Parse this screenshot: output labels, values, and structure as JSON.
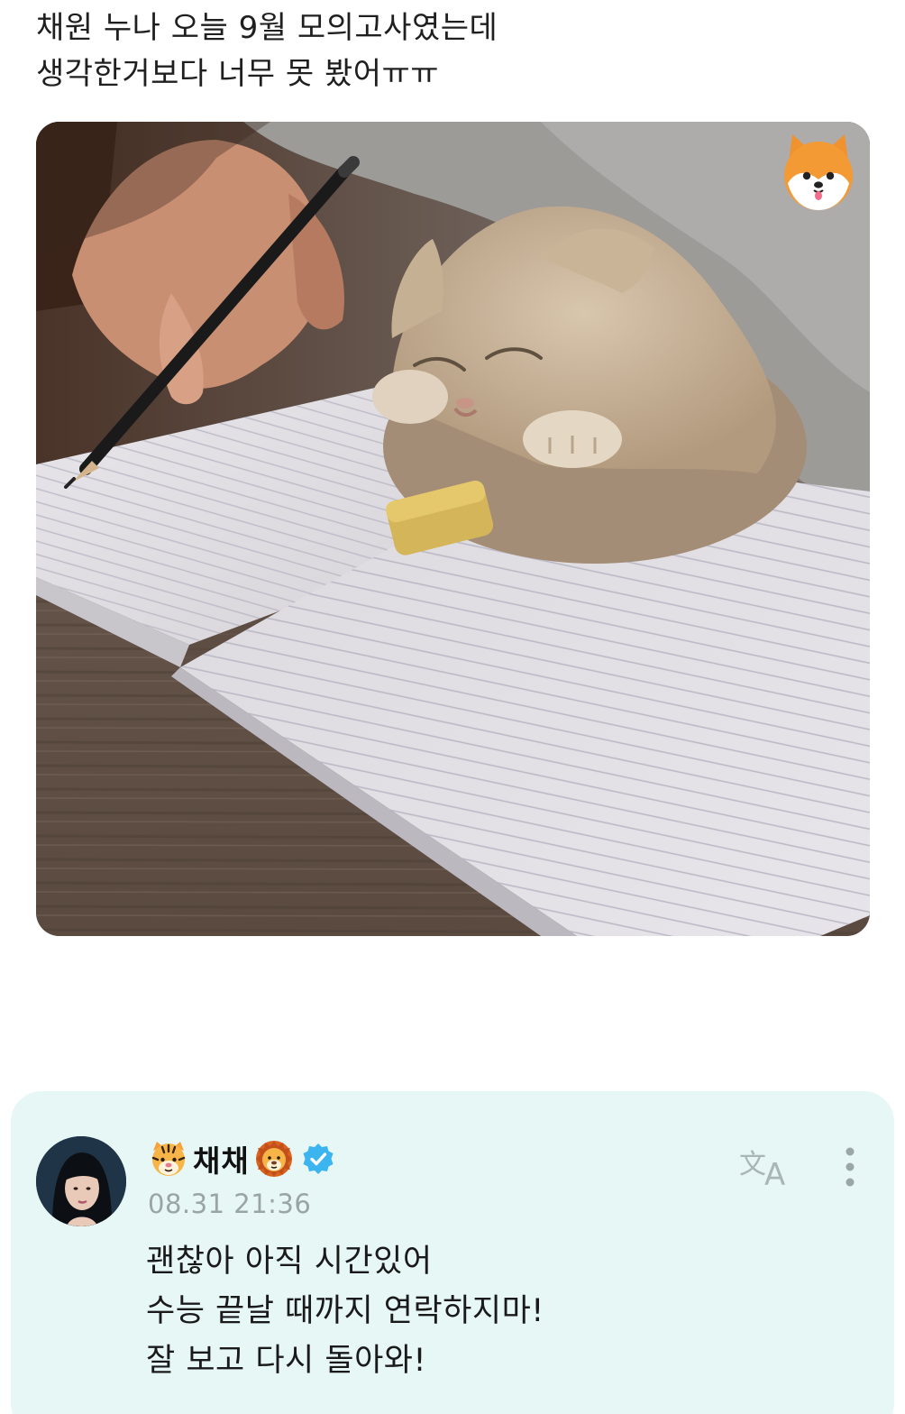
{
  "post": {
    "lines": [
      "채원 누나 오늘 9월 모의고사였는데",
      "생각한거보다 너무 못 봤어ㅠㅠ"
    ],
    "image": {
      "subject": "sleepy-cat-on-notebook",
      "badge_icon": "shiba-dog-icon"
    }
  },
  "reply": {
    "username": "채채",
    "prefix_emoji": "tiger-face-icon",
    "suffix_emoji": "lion-face-icon",
    "verified_icon": "verified-badge-icon",
    "timestamp": "08.31 21:36",
    "lines": [
      "괜찮아 아직 시간있어",
      "수능 끝날 때까지 연락하지마!",
      "잘 보고 다시 돌아와!"
    ],
    "actions": {
      "translate_icon": "translate-icon",
      "more_icon": "more-vertical-icon"
    },
    "colors": {
      "card_background": "#e6f7f6",
      "verified": "#3cb4f0",
      "timestamp": "#9aa4a6"
    }
  }
}
